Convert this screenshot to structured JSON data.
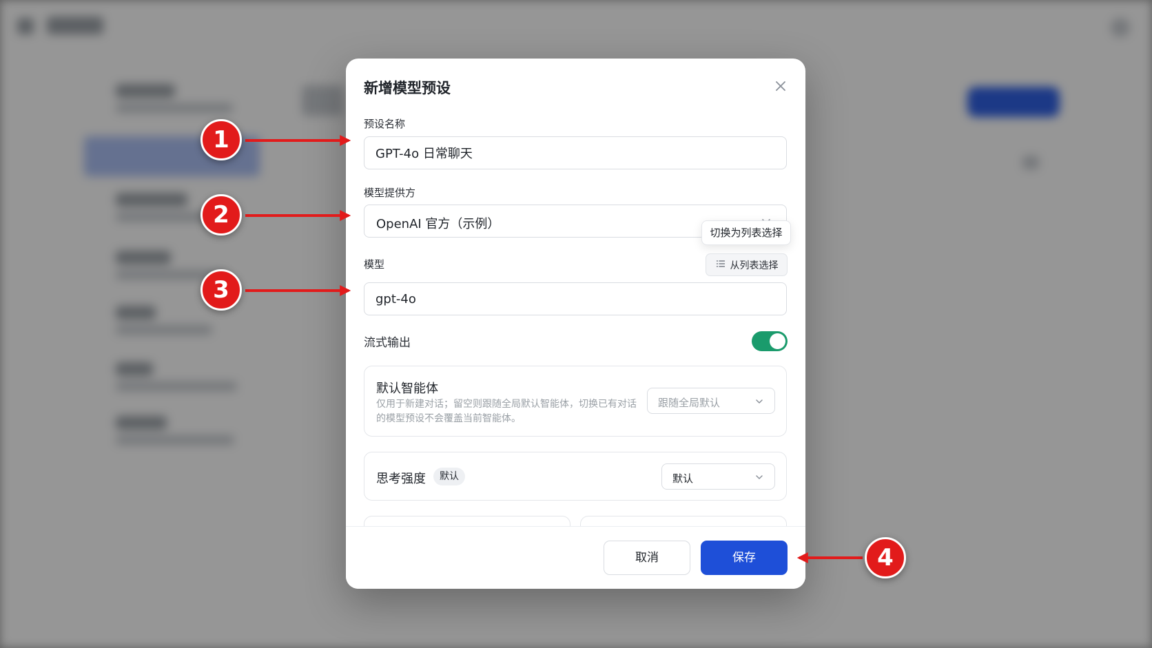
{
  "modal": {
    "title": "新增模型预设",
    "preset_name": {
      "label": "预设名称",
      "value": "GPT-4o 日常聊天"
    },
    "provider": {
      "label": "模型提供方",
      "value": "OpenAI 官方（示例）"
    },
    "tooltip": "切换为列表选择",
    "model": {
      "label": "模型",
      "list_button_label": "从列表选择",
      "value": "gpt-4o"
    },
    "stream": {
      "label": "流式输出",
      "enabled": true
    },
    "default_agent": {
      "title": "默认智能体",
      "description": "仅用于新建对话；留空则跟随全局默认智能体，切换已有对话的模型预设不会覆盖当前智能体。",
      "select_value": "跟随全局默认"
    },
    "thinking": {
      "title": "思考强度",
      "badge": "默认",
      "select_value": "默认"
    },
    "cancel_label": "取消",
    "save_label": "保存"
  },
  "callouts": [
    "1",
    "2",
    "3",
    "4"
  ],
  "colors": {
    "primary": "#1e4fd8",
    "toggle_on": "#1a9b6c",
    "callout": "#e21b1b"
  }
}
